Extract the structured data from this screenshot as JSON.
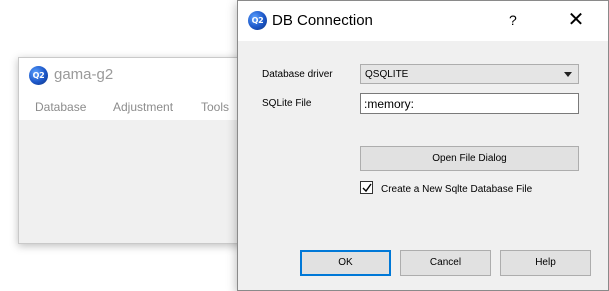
{
  "main_window": {
    "logo_text": "Q2",
    "title": "gama-g2",
    "menu": [
      "Database",
      "Adjustment",
      "Tools"
    ]
  },
  "dialog": {
    "logo_text": "Q2",
    "title": "DB Connection",
    "help_glyph": "?",
    "close_glyph": "✕",
    "driver_label": "Database driver",
    "driver_value": "QSQLITE",
    "file_label": "SQLite File",
    "file_value": ":memory:",
    "open_file_button": "Open File Dialog",
    "create_checkbox_label": "Create a New Sqlte Database File",
    "create_checked": true,
    "ok_button": "OK",
    "cancel_button": "Cancel",
    "help_button": "Help"
  },
  "colors": {
    "accent": "#0078d7",
    "logo": "#1c57c8"
  },
  "icons": {
    "app_logo": "q2-logo-icon",
    "help": "help-icon",
    "close": "close-icon",
    "dropdown": "chevron-down-icon",
    "check": "check-icon"
  }
}
